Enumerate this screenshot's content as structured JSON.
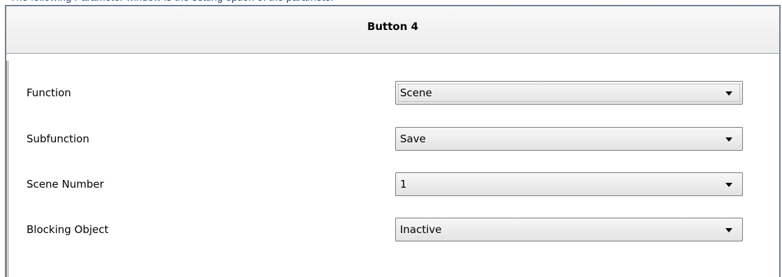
{
  "caption": "The following  Parameter window is the setting option of the parameter",
  "window": {
    "title": "Button 4"
  },
  "rows": [
    {
      "label": "Function",
      "value": "Scene"
    },
    {
      "label": "Subfunction",
      "value": "Save"
    },
    {
      "label": "Scene Number",
      "value": "1"
    },
    {
      "label": "Blocking Object",
      "value": "Inactive"
    }
  ],
  "icons": {
    "dropdown": "chevron-down-icon"
  }
}
